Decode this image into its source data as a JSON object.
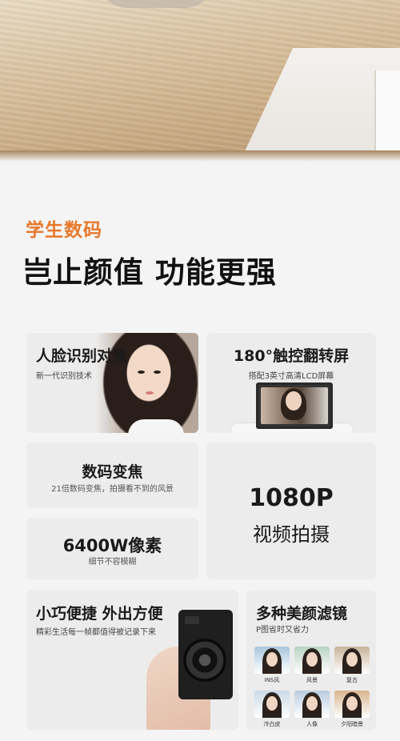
{
  "category": "学生数码",
  "headline": "岂止颜值 功能更强",
  "features": {
    "face": {
      "title": "人脸识别对焦",
      "sub": "新一代识别技术"
    },
    "screen": {
      "title": "180°触控翻转屏",
      "sub": "搭配3英寸高清LCD屏幕"
    },
    "zoom": {
      "title": "数码变焦",
      "sub": "21倍数码变焦，拍摄看不到的风景"
    },
    "pixels": {
      "title": "6400W像素",
      "sub": "细节不容模糊"
    },
    "video": {
      "line1": "1080P",
      "line2": "视频拍摄"
    },
    "portable": {
      "title": "小巧便捷 外出方便",
      "sub": "精彩生活每一帧都值得被记录下来"
    },
    "filters": {
      "title": "多种美颜滤镜",
      "sub": "P图省时又省力",
      "items": [
        {
          "label": "INS风",
          "color": "#a9c6dd"
        },
        {
          "label": "风景",
          "color": "#b9d2c2"
        },
        {
          "label": "复古",
          "color": "#c7b49a"
        },
        {
          "label": "冷白皮",
          "color": "#c9d8e6"
        },
        {
          "label": "人像",
          "color": "#b8cbe0"
        },
        {
          "label": "夕阳暗景",
          "color": "#d8b48c"
        }
      ]
    }
  }
}
